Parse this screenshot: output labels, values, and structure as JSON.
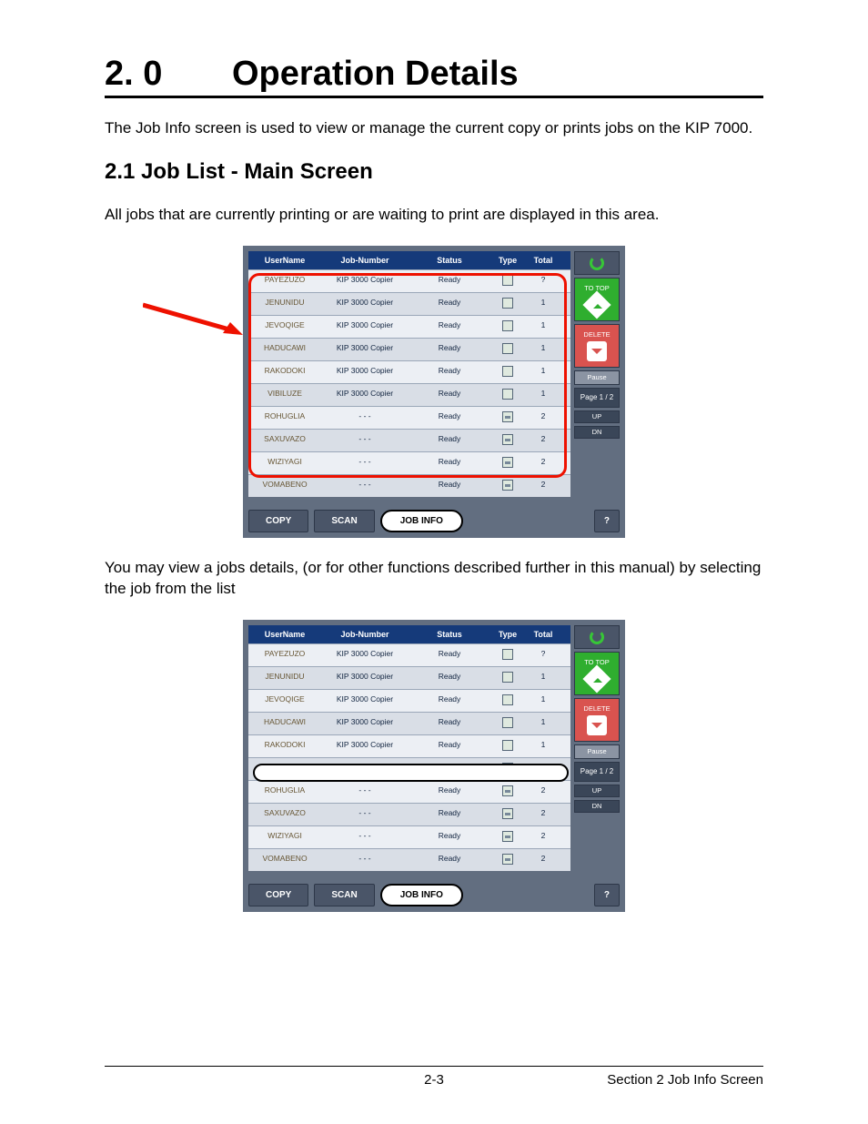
{
  "heading": {
    "number": "2. 0",
    "title": "Operation Details"
  },
  "para1": "The Job Info screen is used to view or manage the current copy or prints jobs on the KIP 7000.",
  "section": "2.1  Job List - Main Screen",
  "para2": "All jobs that are currently printing or are waiting to print are displayed in this area.",
  "para3": "You may view a jobs details, (or for other functions described further in this manual) by selecting the job from the list",
  "footer": {
    "page": "2-3",
    "section": "Section 2    Job Info Screen"
  },
  "ui": {
    "headers": {
      "user": "UserName",
      "job": "Job-Number",
      "status": "Status",
      "type": "Type",
      "total": "Total"
    },
    "rows": [
      {
        "user": "PAYEZUZO",
        "job": "KIP 3000 Copier",
        "status": "Ready",
        "type": "doc",
        "total": "?"
      },
      {
        "user": "JENUNIDU",
        "job": "KIP 3000 Copier",
        "status": "Ready",
        "type": "doc",
        "total": "1"
      },
      {
        "user": "JEVOQIGE",
        "job": "KIP 3000 Copier",
        "status": "Ready",
        "type": "doc",
        "total": "1"
      },
      {
        "user": "HADUCAWI",
        "job": "KIP 3000 Copier",
        "status": "Ready",
        "type": "doc",
        "total": "1"
      },
      {
        "user": "RAKODOKI",
        "job": "KIP 3000 Copier",
        "status": "Ready",
        "type": "doc",
        "total": "1"
      },
      {
        "user": "VIBILUZE",
        "job": "KIP 3000 Copier",
        "status": "Ready",
        "type": "doc",
        "total": "1"
      },
      {
        "user": "ROHUGLIA",
        "job": "- - -",
        "status": "Ready",
        "type": "printer",
        "total": "2"
      },
      {
        "user": "SAXUVAZO",
        "job": "- - -",
        "status": "Ready",
        "type": "printer",
        "total": "2"
      },
      {
        "user": "WIZIYAGI",
        "job": "- - -",
        "status": "Ready",
        "type": "printer",
        "total": "2"
      },
      {
        "user": "VOMABENO",
        "job": "- - -",
        "status": "Ready",
        "type": "printer",
        "total": "2"
      }
    ],
    "side": {
      "totop": "TO TOP",
      "delete": "DELETE",
      "pause": "Pause",
      "page": "Page  1 / 2",
      "up": "UP",
      "dn": "DN"
    },
    "tabs": {
      "copy": "COPY",
      "scan": "SCAN",
      "jobinfo": "JOB INFO",
      "help": "?"
    }
  }
}
